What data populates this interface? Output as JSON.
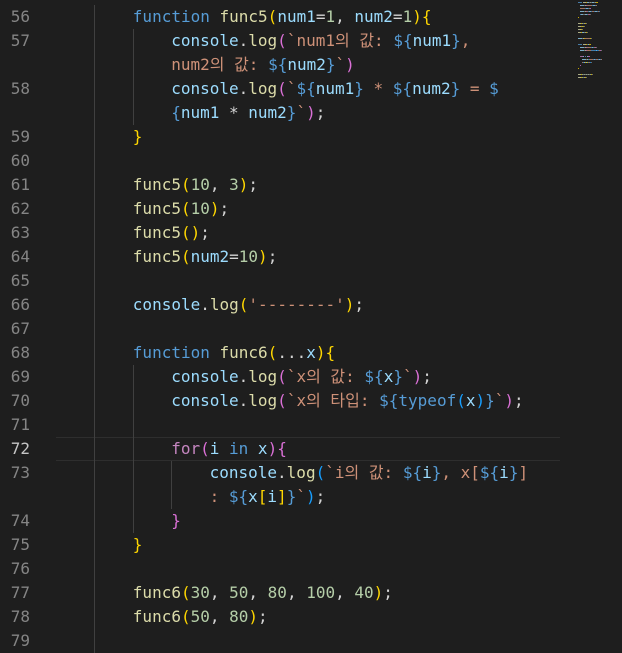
{
  "editor": {
    "line_numbers": [
      "56",
      "57",
      "",
      "58",
      "",
      "59",
      "60",
      "61",
      "62",
      "63",
      "64",
      "65",
      "66",
      "67",
      "68",
      "69",
      "70",
      "71",
      "72",
      "73",
      "",
      "74",
      "75",
      "76",
      "77",
      "78",
      "79"
    ],
    "active_line": "72",
    "lines": [
      {
        "indent": 2,
        "tokens": [
          [
            "kw",
            "function"
          ],
          [
            "op",
            " "
          ],
          [
            "fn",
            "func5"
          ],
          [
            "p1",
            "("
          ],
          [
            "var",
            "num1"
          ],
          [
            "op",
            "="
          ],
          [
            "num",
            "1"
          ],
          [
            "op",
            ", "
          ],
          [
            "var",
            "num2"
          ],
          [
            "op",
            "="
          ],
          [
            "num",
            "1"
          ],
          [
            "p1",
            ")"
          ],
          [
            "p1",
            "{"
          ]
        ]
      },
      {
        "indent": 3,
        "tokens": [
          [
            "var",
            "console"
          ],
          [
            "op",
            "."
          ],
          [
            "fn",
            "log"
          ],
          [
            "p2",
            "("
          ],
          [
            "str",
            "`num1의 값: "
          ],
          [
            "tpl",
            "${"
          ],
          [
            "var",
            "num1"
          ],
          [
            "tpl",
            "}"
          ],
          [
            "str",
            ","
          ]
        ]
      },
      {
        "indent": 3,
        "tokens": [
          [
            "str",
            "num2의 값: "
          ],
          [
            "tpl",
            "${"
          ],
          [
            "var",
            "num2"
          ],
          [
            "tpl",
            "}"
          ],
          [
            "str",
            "`"
          ],
          [
            "p2",
            ")"
          ]
        ]
      },
      {
        "indent": 3,
        "tokens": [
          [
            "var",
            "console"
          ],
          [
            "op",
            "."
          ],
          [
            "fn",
            "log"
          ],
          [
            "p2",
            "("
          ],
          [
            "str",
            "`"
          ],
          [
            "tpl",
            "${"
          ],
          [
            "var",
            "num1"
          ],
          [
            "tpl",
            "}"
          ],
          [
            "str",
            " * "
          ],
          [
            "tpl",
            "${"
          ],
          [
            "var",
            "num2"
          ],
          [
            "tpl",
            "}"
          ],
          [
            "str",
            " = "
          ],
          [
            "tpl",
            "$"
          ]
        ]
      },
      {
        "indent": 3,
        "tokens": [
          [
            "tpl",
            "{"
          ],
          [
            "var",
            "num1"
          ],
          [
            "op",
            " * "
          ],
          [
            "var",
            "num2"
          ],
          [
            "tpl",
            "}"
          ],
          [
            "str",
            "`"
          ],
          [
            "p2",
            ")"
          ],
          [
            "op",
            ";"
          ]
        ]
      },
      {
        "indent": 2,
        "tokens": [
          [
            "p1",
            "}"
          ]
        ]
      },
      {
        "indent": 0,
        "tokens": []
      },
      {
        "indent": 2,
        "tokens": [
          [
            "fn",
            "func5"
          ],
          [
            "p1",
            "("
          ],
          [
            "num",
            "10"
          ],
          [
            "op",
            ", "
          ],
          [
            "num",
            "3"
          ],
          [
            "p1",
            ")"
          ],
          [
            "op",
            ";"
          ]
        ]
      },
      {
        "indent": 2,
        "tokens": [
          [
            "fn",
            "func5"
          ],
          [
            "p1",
            "("
          ],
          [
            "num",
            "10"
          ],
          [
            "p1",
            ")"
          ],
          [
            "op",
            ";"
          ]
        ]
      },
      {
        "indent": 2,
        "tokens": [
          [
            "fn",
            "func5"
          ],
          [
            "p1",
            "()"
          ],
          [
            "op",
            ";"
          ]
        ]
      },
      {
        "indent": 2,
        "tokens": [
          [
            "fn",
            "func5"
          ],
          [
            "p1",
            "("
          ],
          [
            "var",
            "num2"
          ],
          [
            "op",
            "="
          ],
          [
            "num",
            "10"
          ],
          [
            "p1",
            ")"
          ],
          [
            "op",
            ";"
          ]
        ]
      },
      {
        "indent": 0,
        "tokens": []
      },
      {
        "indent": 2,
        "tokens": [
          [
            "var",
            "console"
          ],
          [
            "op",
            "."
          ],
          [
            "fn",
            "log"
          ],
          [
            "p1",
            "("
          ],
          [
            "str",
            "'--------'"
          ],
          [
            "p1",
            ")"
          ],
          [
            "op",
            ";"
          ]
        ]
      },
      {
        "indent": 0,
        "tokens": []
      },
      {
        "indent": 2,
        "tokens": [
          [
            "kw",
            "function"
          ],
          [
            "op",
            " "
          ],
          [
            "fn",
            "func6"
          ],
          [
            "p1",
            "("
          ],
          [
            "op",
            "..."
          ],
          [
            "var",
            "x"
          ],
          [
            "p1",
            ")"
          ],
          [
            "p1",
            "{"
          ]
        ]
      },
      {
        "indent": 3,
        "tokens": [
          [
            "var",
            "console"
          ],
          [
            "op",
            "."
          ],
          [
            "fn",
            "log"
          ],
          [
            "p2",
            "("
          ],
          [
            "str",
            "`x의 값: "
          ],
          [
            "tpl",
            "${"
          ],
          [
            "var",
            "x"
          ],
          [
            "tpl",
            "}"
          ],
          [
            "str",
            "`"
          ],
          [
            "p2",
            ")"
          ],
          [
            "op",
            ";"
          ]
        ]
      },
      {
        "indent": 3,
        "tokens": [
          [
            "var",
            "console"
          ],
          [
            "op",
            "."
          ],
          [
            "fn",
            "log"
          ],
          [
            "p2",
            "("
          ],
          [
            "str",
            "`x의 타입: "
          ],
          [
            "tpl",
            "${"
          ],
          [
            "kw",
            "typeof"
          ],
          [
            "p3",
            "("
          ],
          [
            "var",
            "x"
          ],
          [
            "p3",
            ")"
          ],
          [
            "tpl",
            "}"
          ],
          [
            "str",
            "`"
          ],
          [
            "p2",
            ")"
          ],
          [
            "op",
            ";"
          ]
        ]
      },
      {
        "indent": 0,
        "tokens": []
      },
      {
        "indent": 3,
        "tokens": [
          [
            "ctl",
            "for"
          ],
          [
            "p2",
            "("
          ],
          [
            "var",
            "i"
          ],
          [
            "op",
            " "
          ],
          [
            "kw",
            "in"
          ],
          [
            "op",
            " "
          ],
          [
            "var",
            "x"
          ],
          [
            "p2",
            ")"
          ],
          [
            "p2",
            "{"
          ]
        ]
      },
      {
        "indent": 4,
        "tokens": [
          [
            "var",
            "console"
          ],
          [
            "op",
            "."
          ],
          [
            "fn",
            "log"
          ],
          [
            "p3",
            "("
          ],
          [
            "str",
            "`i의 값: "
          ],
          [
            "tpl",
            "${"
          ],
          [
            "var",
            "i"
          ],
          [
            "tpl",
            "}"
          ],
          [
            "str",
            ", x["
          ],
          [
            "tpl",
            "${"
          ],
          [
            "var",
            "i"
          ],
          [
            "tpl",
            "}"
          ],
          [
            "str",
            "]"
          ]
        ]
      },
      {
        "indent": 4,
        "tokens": [
          [
            "str",
            ": "
          ],
          [
            "tpl",
            "${"
          ],
          [
            "var",
            "x"
          ],
          [
            "p1",
            "["
          ],
          [
            "var",
            "i"
          ],
          [
            "p1",
            "]"
          ],
          [
            "tpl",
            "}"
          ],
          [
            "str",
            "`"
          ],
          [
            "p3",
            ")"
          ],
          [
            "op",
            ";"
          ]
        ]
      },
      {
        "indent": 3,
        "tokens": [
          [
            "p2",
            "}"
          ]
        ]
      },
      {
        "indent": 2,
        "tokens": [
          [
            "p1",
            "}"
          ]
        ]
      },
      {
        "indent": 0,
        "tokens": []
      },
      {
        "indent": 2,
        "tokens": [
          [
            "fn",
            "func6"
          ],
          [
            "p1",
            "("
          ],
          [
            "num",
            "30"
          ],
          [
            "op",
            ", "
          ],
          [
            "num",
            "50"
          ],
          [
            "op",
            ", "
          ],
          [
            "num",
            "80"
          ],
          [
            "op",
            ", "
          ],
          [
            "num",
            "100"
          ],
          [
            "op",
            ", "
          ],
          [
            "num",
            "40"
          ],
          [
            "p1",
            ")"
          ],
          [
            "op",
            ";"
          ]
        ]
      },
      {
        "indent": 2,
        "tokens": [
          [
            "fn",
            "func6"
          ],
          [
            "p1",
            "("
          ],
          [
            "num",
            "50"
          ],
          [
            "op",
            ", "
          ],
          [
            "num",
            "80"
          ],
          [
            "p1",
            ")"
          ],
          [
            "op",
            ";"
          ]
        ]
      },
      {
        "indent": 0,
        "tokens": []
      }
    ]
  },
  "colors": {
    "background": "#1e1e1e",
    "line_number": "#858585",
    "keyword": "#569cd6",
    "function": "#dcdcaa",
    "variable": "#9cdcfe",
    "number": "#b5cea8",
    "string": "#ce9178"
  }
}
